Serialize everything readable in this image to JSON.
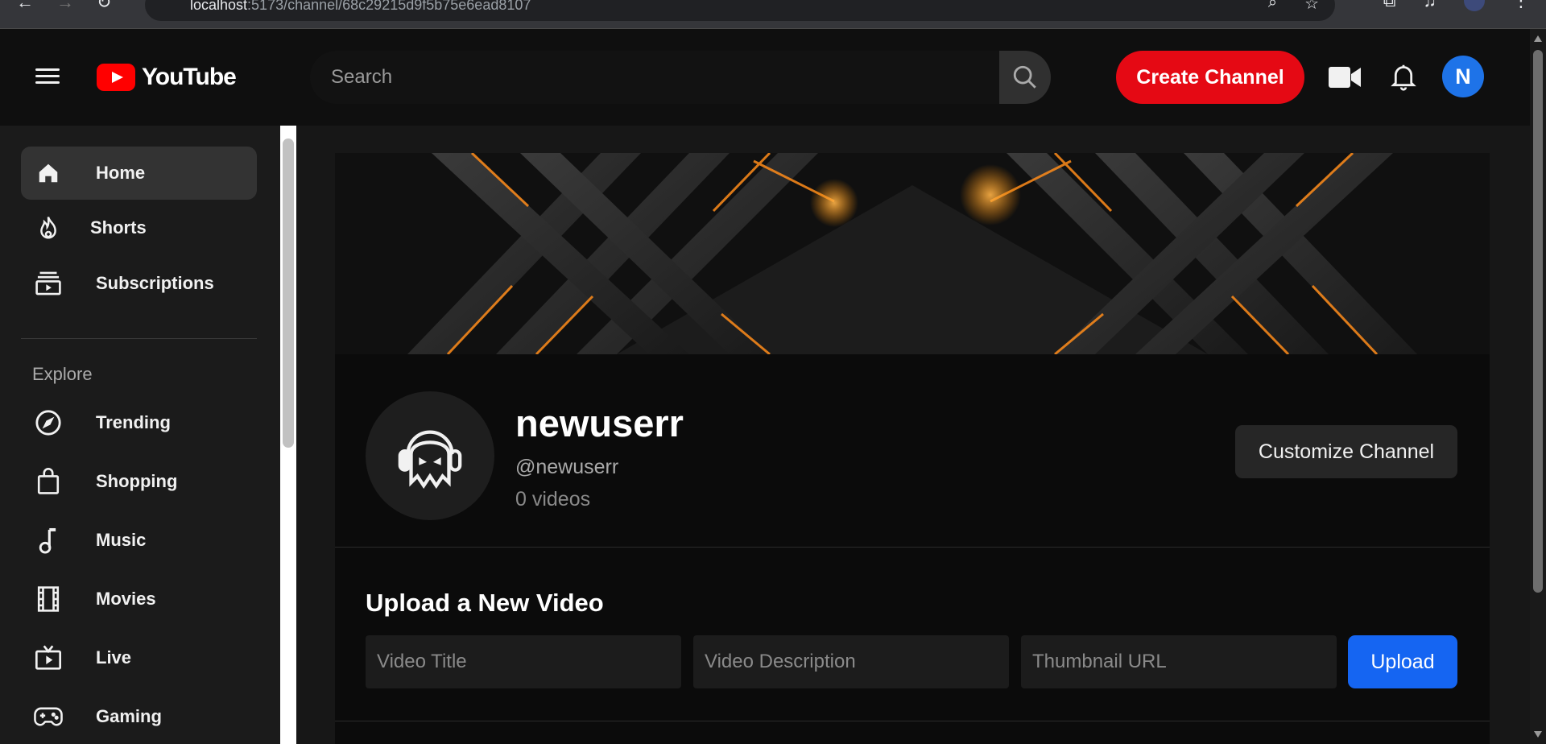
{
  "browser": {
    "url_host": "localhost",
    "url_path": ":5173/channel/68c29215d9f5b75e6ead8107"
  },
  "header": {
    "logo_text": "YouTube",
    "search_placeholder": "Search",
    "create_channel_label": "Create Channel",
    "user_initial": "N"
  },
  "sidebar": {
    "items": [
      {
        "label": "Home",
        "icon": "home-icon"
      },
      {
        "label": "Shorts",
        "icon": "flame-icon"
      },
      {
        "label": "Subscriptions",
        "icon": "subscriptions-icon"
      }
    ],
    "explore_heading": "Explore",
    "explore_items": [
      {
        "label": "Trending",
        "icon": "compass-icon"
      },
      {
        "label": "Shopping",
        "icon": "shopping-bag-icon"
      },
      {
        "label": "Music",
        "icon": "music-note-icon"
      },
      {
        "label": "Movies",
        "icon": "film-icon"
      },
      {
        "label": "Live",
        "icon": "live-tv-icon"
      },
      {
        "label": "Gaming",
        "icon": "gamepad-icon"
      }
    ]
  },
  "channel": {
    "name": "newuserr",
    "handle": "@newuserr",
    "video_count": "0 videos",
    "customize_label": "Customize Channel"
  },
  "upload": {
    "title": "Upload a New Video",
    "title_placeholder": "Video Title",
    "description_placeholder": "Video Description",
    "thumbnail_placeholder": "Thumbnail URL",
    "upload_label": "Upload"
  },
  "colors": {
    "accent_red": "#e50914",
    "upload_blue": "#1565f2",
    "avatar_blue": "#1e73e8"
  }
}
